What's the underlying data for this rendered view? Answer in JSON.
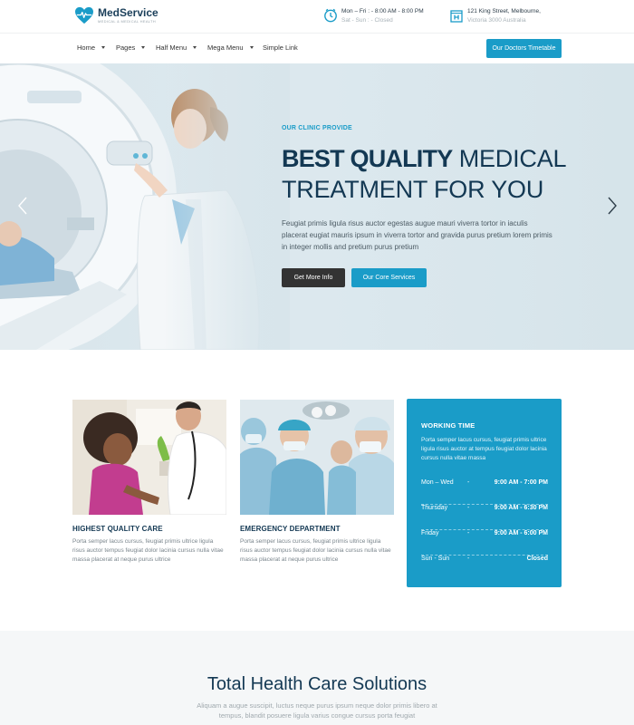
{
  "brand": {
    "name": "MedService",
    "tagline": "MEDICAL & MEDICAL HEALTH",
    "accent_color": "#1a9cc8",
    "navy_color": "#133853"
  },
  "header": {
    "hours": {
      "icon": "clock-icon",
      "main": "Mon – Fri : - 8:00 AM - 8:00 PM",
      "sub": "Sat - Sun : - Closed"
    },
    "address": {
      "icon": "hospital-icon",
      "main": "121 King Street, Melbourne,",
      "sub": "Victoria 3000 Australia"
    }
  },
  "nav": {
    "items": [
      {
        "label": "Home",
        "has_caret": true
      },
      {
        "label": "Pages",
        "has_caret": true
      },
      {
        "label": "Half Menu",
        "has_caret": true
      },
      {
        "label": "Mega Menu",
        "has_caret": true
      },
      {
        "label": "Simple Link",
        "has_caret": false
      }
    ],
    "cta": "Our Doctors Timetable"
  },
  "hero": {
    "kicker": "OUR CLINIC PROVIDE",
    "title_strong": "BEST QUALITY",
    "title_rest": " MEDICAL TREATMENT FOR YOU",
    "description": "Feugiat primis ligula risus auctor egestas augue mauri viverra tortor in iaculis placerat eugiat mauris ipsum in viverra tortor and gravida purus pretium lorem primis in integer mollis and pretium purus pretium",
    "primary_button": "Get More Info",
    "secondary_button": "Our Core Services",
    "prev_icon": "chevron-left-icon",
    "next_icon": "chevron-right-icon"
  },
  "features": [
    {
      "title": "HIGHEST QUALITY CARE",
      "text": "Porta semper lacus cursus, feugiat primis ultrice ligula risus auctor tempus feugiat dolor lacinia cursus nulla vitae massa placerat at neque purus ultrice"
    },
    {
      "title": "EMERGENCY DEPARTMENT",
      "text": "Porta semper lacus cursus, feugiat primis ultrice ligula risus auctor tempus feugiat dolor lacinia cursus nulla vitae massa placerat at neque purus ultrice"
    }
  ],
  "working_time": {
    "title": "WORKING TIME",
    "description": "Porta semper lacus cursus, feugiat primis ultrice ligula risus auctor at tempus feugiat dolor lacinia cursus nulla vitae massa",
    "rows": [
      {
        "day": "Mon – Wed",
        "sep": "-",
        "time": "9:00 AM - 7:00 PM"
      },
      {
        "day": "Thursday",
        "sep": "-",
        "time": "9:00 AM - 6:30 PM"
      },
      {
        "day": "Friday",
        "sep": "-",
        "time": "9:00 AM - 6:00 PM"
      },
      {
        "day": "Sun - Sun",
        "sep": "-",
        "time": "Closed"
      }
    ]
  },
  "solutions": {
    "title": "Total Health Care Solutions",
    "description": "Aliquam a augue suscipit, luctus neque purus ipsum neque dolor primis libero at tempus, blandit posuere ligula varius congue cursus porta feugiat"
  }
}
